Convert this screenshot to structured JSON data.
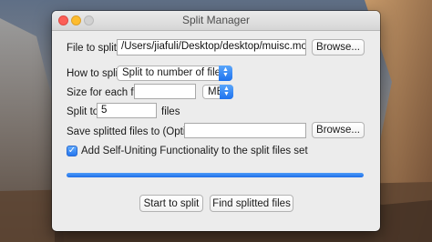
{
  "window": {
    "title": "Split Manager"
  },
  "file_to_split": {
    "label": "File to split",
    "value": "/Users/jiafuli/Desktop/desktop/muisc.mov",
    "browse_label": "Browse..."
  },
  "how_to_split": {
    "label": "How to split",
    "selected": "Split to number of files"
  },
  "size_each_file": {
    "label": "Size for each file",
    "value": "",
    "unit_selected": "MB"
  },
  "split_to": {
    "label": "Split to",
    "value": "5",
    "suffix": "files"
  },
  "save_to": {
    "label": "Save splitted files to (Optional)",
    "value": "",
    "browse_label": "Browse..."
  },
  "self_uniting": {
    "label": "Add Self-Uniting Functionality to the split files set",
    "checked": true,
    "check_glyph": "✓"
  },
  "progress": {
    "value": 1.0
  },
  "actions": {
    "start_label": "Start to split",
    "find_label": "Find splitted files"
  },
  "colors": {
    "accent": "#1f6fe8",
    "close": "#fc5f57",
    "minimize": "#fdbc2e",
    "maximize_disabled": "#d1d1d1"
  },
  "icons": {
    "select_arrows": "▲▼",
    "close": "close-traffic-light",
    "minimize": "minimize-traffic-light",
    "zoom": "zoom-traffic-light"
  }
}
